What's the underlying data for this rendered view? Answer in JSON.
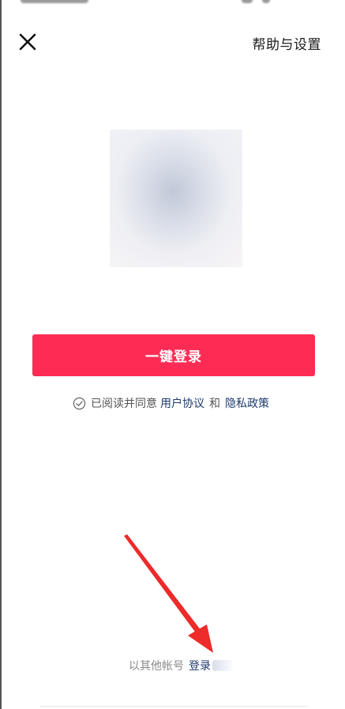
{
  "header": {
    "close_icon": "close-icon",
    "help_label": "帮助与设置"
  },
  "avatar": {
    "icon": "avatar-placeholder"
  },
  "login": {
    "button_label": "一键登录"
  },
  "agreement": {
    "check_icon": "check-circle-icon",
    "prefix": "已阅读并同意",
    "user_agreement": "用户协议",
    "and": "和",
    "privacy_policy": "隐私政策"
  },
  "other_login": {
    "prefix": "以其他帐号",
    "link": "登录"
  },
  "colors": {
    "accent": "#fe2c55",
    "link": "#1e3a6e",
    "arrow": "#ee2a2a"
  }
}
